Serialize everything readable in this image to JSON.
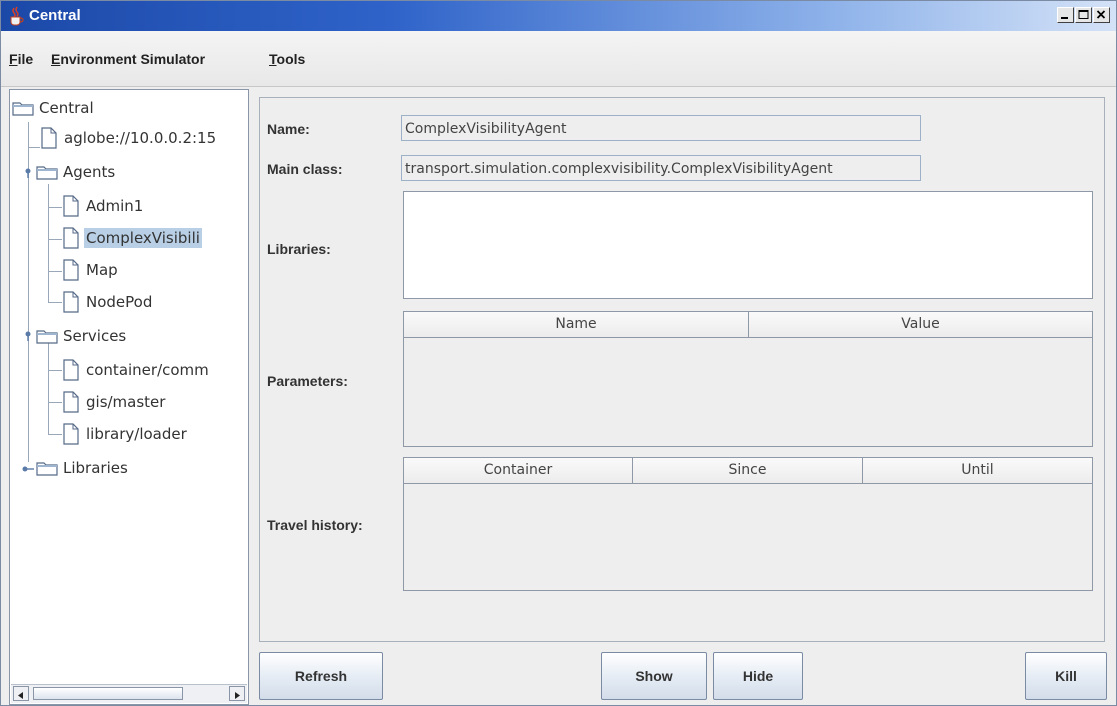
{
  "window": {
    "title": "Central"
  },
  "menu": [
    {
      "label": "File",
      "mnemonic": "F",
      "rest": "ile"
    },
    {
      "label": "Environment Simulator",
      "mnemonic": "E",
      "rest": "nvironment Simulator"
    },
    {
      "label": "Tools",
      "mnemonic": "T",
      "rest": "ools"
    }
  ],
  "tree": {
    "root": "Central",
    "address": "aglobe://10.0.0.2:15",
    "agents_label": "Agents",
    "agents": [
      "Admin1",
      "ComplexVisibili",
      "Map",
      "NodePod"
    ],
    "services_label": "Services",
    "services": [
      "container/comm",
      "gis/master",
      "library/loader"
    ],
    "libraries_label": "Libraries",
    "selected": "ComplexVisibili"
  },
  "details": {
    "name_label": "Name:",
    "name_value": "ComplexVisibilityAgent",
    "main_class_label": "Main class:",
    "main_class_value": "transport.simulation.complexvisibility.ComplexVisibilityAgent",
    "libraries_label": "Libraries:",
    "parameters_label": "Parameters:",
    "parameters_columns": [
      "Name",
      "Value"
    ],
    "travel_label": "Travel history:",
    "travel_columns": [
      "Container",
      "Since",
      "Until"
    ]
  },
  "buttons": {
    "refresh": "Refresh",
    "show": "Show",
    "hide": "Hide",
    "kill": "Kill"
  },
  "colors": {
    "titlebar": "#2f63c9",
    "selection": "#b8cfe5"
  }
}
